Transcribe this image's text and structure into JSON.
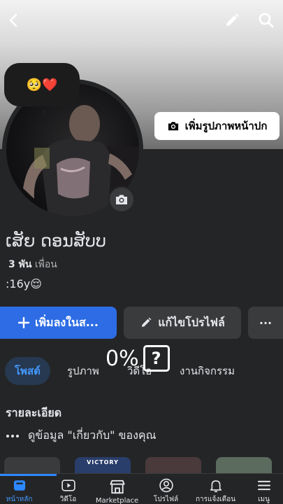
{
  "header": {
    "back_icon": "chevron-left-icon",
    "edit_icon": "pencil-icon",
    "search_icon": "search-icon"
  },
  "story": {
    "emoji": "🥺❤️"
  },
  "cover": {
    "add_cover_label": "เพิ่มรูปภาพหน้าปก"
  },
  "profile": {
    "name": "ເສັຍ ດອນສັບບ",
    "friends_count": "3 พัน",
    "friends_label": "เพื่อน",
    "bio": ":16y😌"
  },
  "actions": {
    "add_story_label": "เพิ่มลงในส...",
    "edit_profile_label": "แก้ไขโปรไฟล์",
    "more_label": "···"
  },
  "loading": {
    "percent": "0%",
    "symbol": "?"
  },
  "tabs": [
    {
      "label": "โพสต์",
      "active": true
    },
    {
      "label": "รูปภาพ"
    },
    {
      "label": "วิดีโอ"
    },
    {
      "label": "งานกิจกรรม"
    }
  ],
  "about": {
    "title": "รายละเอียด",
    "see_about_label": "ดูข้อมูล \"เกี่ยวกับ\" ของคุณ",
    "thumbnail_text": "VICTORY"
  },
  "bottom_nav": [
    {
      "label": "หน้าหลัก",
      "icon": "home-feed-icon",
      "active": true
    },
    {
      "label": "วิดีโอ",
      "icon": "video-icon"
    },
    {
      "label": "Marketplace",
      "icon": "marketplace-icon"
    },
    {
      "label": "โปรไฟล์",
      "icon": "profile-icon"
    },
    {
      "label": "การแจ้งเตือน",
      "icon": "bell-icon"
    },
    {
      "label": "เมนู",
      "icon": "menu-icon"
    }
  ],
  "colors": {
    "accent": "#2d6ce4",
    "active_tab_bg": "#263951",
    "active_text": "#4599ff",
    "background": "#242526"
  }
}
